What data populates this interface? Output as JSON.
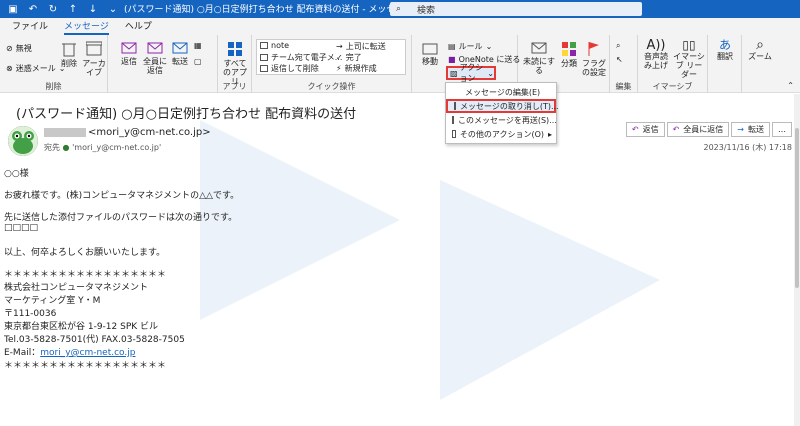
{
  "titlebar": {
    "window_title": "(パスワード通知) ○月○日定例打ち合わせ  配布資料の送付 - メッセージ (テキスト...",
    "search_placeholder": "検索"
  },
  "tabs": [
    "ファイル",
    "メッセージ",
    "ヘルプ"
  ],
  "ribbon": {
    "delete_group": {
      "label": "削除",
      "ignore": "無視",
      "junk": "迷惑メール",
      "delete": "削除",
      "archive": "アーカイブ"
    },
    "reply_group": {
      "reply": "返信",
      "reply_all": "全員に返信",
      "forward": "転送"
    },
    "apps_group": {
      "label": "アプリ",
      "all_apps": "すべてのアプリ"
    },
    "quick_steps": {
      "label": "クイック操作",
      "items": [
        "note",
        "チーム宛て電子メ...",
        "返信して削除",
        "上司に転送",
        "完了",
        "新規作成"
      ]
    },
    "move_group": {
      "move": "移動",
      "rules": "ルール",
      "onenote": "OneNote に送る",
      "actions": "アクション"
    },
    "tags_group": {
      "unread": "未読にする",
      "categorize": "分類",
      "followup": "フラグの設定"
    },
    "edit_group": {
      "label": "編集"
    },
    "immersive": {
      "label": "イマーシブ",
      "read_aloud": "音声読み上げ",
      "immersive_reader": "イマーシブ リーダー"
    },
    "translate": {
      "label": "翻訳"
    },
    "zoom": {
      "label": "ズーム"
    }
  },
  "actions_menu": {
    "items": [
      {
        "label": "メッセージの編集(E)",
        "highlight": false
      },
      {
        "label": "メッセージの取り消し(T)...",
        "highlight": true
      },
      {
        "label": "このメッセージを再送(S)...",
        "highlight": false
      },
      {
        "label": "その他のアクション(O)",
        "highlight": false
      }
    ]
  },
  "message": {
    "subject": "(パスワード通知) ○月○日定例打ち合わせ  配布資料の送付",
    "sender_email": "<mori_y@cm-net.co.jp>",
    "to_label": "宛先",
    "to_value": "'mori_y@cm-net.co.jp'",
    "date": "2023/11/16 (木) 17:18",
    "reply_buttons": {
      "reply": "返信",
      "reply_all": "全員に返信",
      "forward": "転送"
    },
    "body": {
      "greeting": "○○様",
      "l1": "お疲れ様です。(株)コンピュータマネジメントの△△です。",
      "l2": "先に送信した添付ファイルのパスワードは次の通りです。",
      "l3": "□□□□",
      "l4": "以上、何卒よろしくお願いいたします。",
      "sig_line": "＊＊＊＊＊＊＊＊＊＊＊＊＊＊＊＊＊＊",
      "sig_company": "株式会社コンピュータマネジメント",
      "sig_dept": "マーケティング室     Y・M",
      "sig_zip": "〒111-0036",
      "sig_addr": "東京都台東区松が谷 1-9-12   SPK ビル",
      "sig_tel": "Tel.03-5828-7501(代)   FAX.03-5828-7505",
      "sig_mail_label": "E-Mail：",
      "sig_mail": "mori_y@cm-net.co.jp",
      "sig_line2": "＊＊＊＊＊＊＊＊＊＊＊＊＊＊＊＊＊＊"
    }
  },
  "colors": {
    "accent": "#1565c0",
    "highlight_border": "#e53935"
  }
}
